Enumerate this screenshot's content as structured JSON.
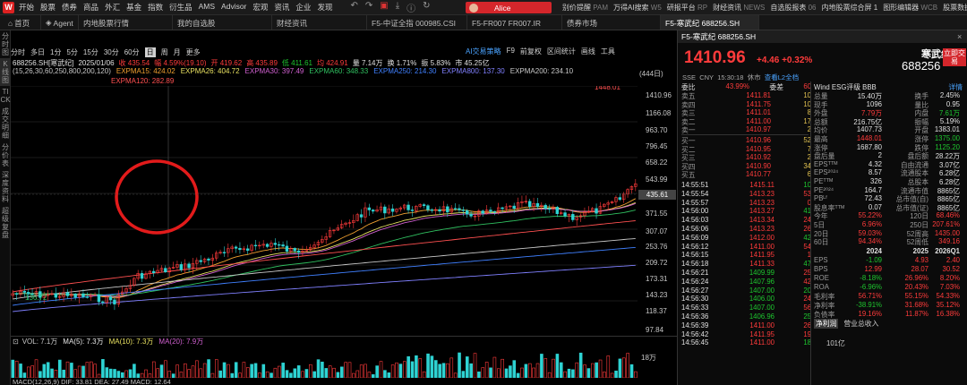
{
  "topbar": {
    "logo": "W",
    "menu": [
      "开始",
      "股票",
      "债券",
      "商品",
      "外汇",
      "基金",
      "指数",
      "衍生品",
      "AMS",
      "Advisor",
      "宏观",
      "资讯",
      "企业",
      "发现"
    ],
    "user": "Alice",
    "links": [
      {
        "t": "别价提醒",
        "g": "PAM"
      },
      {
        "t": "万得AI搜索",
        "g": "W5"
      },
      {
        "t": "研报平台",
        "g": "RP"
      },
      {
        "t": "财经资讯",
        "g": "NEWS"
      },
      {
        "t": "自选股报表",
        "g": "06"
      },
      {
        "t": "内地股票综合屏 1",
        "g": ""
      },
      {
        "t": "图形编辑器",
        "g": "WCB"
      },
      {
        "t": "股票数据浏览器",
        "g": "EDE"
      }
    ]
  },
  "tabs": [
    "首页",
    "Agent",
    "内地股票行情",
    "我的自选股",
    "财经资讯",
    "F5-中证全指 000985.CSI",
    "F5-FR007 FR007.IR",
    "债券市场",
    "F5-寒武纪 688256.SH"
  ],
  "lefttools": [
    "分时图",
    "K线图",
    "TICK",
    "成交明细",
    "分价表",
    "深度资料",
    "超级复盘"
  ],
  "periods": [
    "分时",
    "多日",
    "1分",
    "5分",
    "15分",
    "30分",
    "60分",
    "日",
    "周",
    "月",
    "更多"
  ],
  "selected_period": "日",
  "chart_links": [
    {
      "t": "AI交易策略",
      "c": "blue"
    },
    {
      "t": "F9",
      "c": ""
    },
    {
      "t": "前复权",
      "c": ""
    },
    {
      "t": "区间统计",
      "c": ""
    },
    {
      "t": "画线",
      "c": ""
    },
    {
      "t": "工具",
      "c": ""
    }
  ],
  "info": [
    {
      "t": "688256.SH[寒武纪]",
      "c": "wh"
    },
    {
      "t": "2025/01/06",
      "c": "wh"
    },
    {
      "t": "收 435.54",
      "c": "up"
    },
    {
      "t": "幅 4.59%(19.10)",
      "c": "up"
    },
    {
      "t": "开 419.62",
      "c": "up"
    },
    {
      "t": "高 435.89",
      "c": "up"
    },
    {
      "t": "低 411.61",
      "c": "dn"
    },
    {
      "t": "均 424.91",
      "c": "up"
    },
    {
      "t": "量 7.14万",
      "c": "wh"
    },
    {
      "t": "换 1.71%",
      "c": "wh"
    },
    {
      "t": "振 5.83%",
      "c": "wh"
    },
    {
      "t": "市 45.25亿",
      "c": "wh"
    }
  ],
  "ma_params": "(15,26,30,60,250,800,200,120)",
  "ma_line1": [
    {
      "t": "EXPMA15: 424.02",
      "c": "#f0a030"
    },
    {
      "t": "EXPMA26: 404.72",
      "c": "#e8e060"
    },
    {
      "t": "EXPMA30: 397.49",
      "c": "#d060d0"
    },
    {
      "t": "EXPMA60: 348.33",
      "c": "#30c060"
    },
    {
      "t": "EXPMA250: 214.30",
      "c": "#4080ff"
    },
    {
      "t": "EXPMA800: 137.30",
      "c": "#8080ff"
    },
    {
      "t": "EXPMA200: 234.10",
      "c": "#c8c8c8"
    }
  ],
  "ma_line2": {
    "t": "EXPMA120: 282.89",
    "c": "#ff5050"
  },
  "mark_count": "(444日)",
  "yaxis": [
    "1410.96",
    "1166.08",
    "963.70",
    "796.45",
    "658.22",
    "543.99",
    "371.55",
    "307.07",
    "253.76",
    "209.72",
    "173.31",
    "143.23",
    "118.37",
    "97.84"
  ],
  "current_price_tag": "435.61",
  "high_label": "1448.01",
  "low_label": "136.72",
  "vol_line": [
    {
      "t": "VOL: 7.1万",
      "c": "#c8c8c8"
    },
    {
      "t": "MA(5): 7.3万",
      "c": "#e8e8e8"
    },
    {
      "t": "MA(10): 7.3万",
      "c": "#e8e060"
    },
    {
      "t": "MA(20): 7.9万",
      "c": "#d060d0"
    }
  ],
  "vol_axis": "18万",
  "macd_line": "MACD(12,26,9)  DIF: 33.81  DEA: 27.49  MACD: 12.64",
  "chart_data": {
    "type": "candlestick",
    "trend": "from ~136.72 low to 1448.01 high over 444 days",
    "ylim": [
      97.84,
      1448.01
    ],
    "y_scale": "log",
    "last_close": 1410.96,
    "annotations": [
      "1448.01",
      "136.72"
    ]
  },
  "quote": {
    "title": "F5-寒武纪 688256.SH",
    "price": "1410.96",
    "change": "+4.46",
    "pct": "+0.32%",
    "name": "寒武纪",
    "code": "688256",
    "btn": "立即交易",
    "sub1": "SSE",
    "sub2": "CNY",
    "sub3": "15:30:18",
    "sub4": "休市",
    "sub5": "查看L2全档",
    "esg": "Wind ESG评级 BBB",
    "esg_link": "详情"
  },
  "orderbook": {
    "header": [
      "委比",
      "43.99%",
      "委差",
      "60"
    ],
    "sells": [
      [
        "卖五",
        "1411.81",
        "10"
      ],
      [
        "卖四",
        "1411.75",
        "10"
      ],
      [
        "卖三",
        "1411.01",
        "8"
      ],
      [
        "卖二",
        "1411.00",
        "17"
      ],
      [
        "卖一",
        "1410.97",
        "2"
      ]
    ],
    "buys": [
      [
        "买一",
        "1410.96",
        "52"
      ],
      [
        "买二",
        "1410.95",
        "7"
      ],
      [
        "买三",
        "1410.92",
        "2"
      ],
      [
        "买四",
        "1410.90",
        "34"
      ],
      [
        "买五",
        "1410.77",
        "6"
      ]
    ]
  },
  "stats": [
    [
      "总量",
      "15.40万",
      "换手",
      "2.45%"
    ],
    [
      "现手",
      "1096",
      "量比",
      "0.95"
    ],
    [
      "外盘",
      "7.79万",
      "内盘",
      "7.61万"
    ],
    [
      "总额",
      "216.75亿",
      "振幅",
      "5.19%"
    ],
    [
      "均价",
      "1407.73",
      "开盘",
      "1383.01"
    ],
    [
      "最高",
      "1448.01",
      "涨停",
      "1375.00"
    ],
    [
      "涨停",
      "1687.80",
      "跌停",
      "1125.20"
    ],
    [
      "盘后量",
      "2",
      "盘后额",
      "28.22万"
    ],
    [
      "EPSᵀᵀᴹ",
      "4.32",
      "自由流通",
      "3.07亿"
    ],
    [
      "EPS²⁰²⁴",
      "8.57",
      "流通股本",
      "6.28亿"
    ],
    [
      "PEᵀᵀᴹ",
      "326",
      "总股本",
      "6.28亿"
    ],
    [
      "PE²⁰²⁴",
      "164.7",
      "流通市值",
      "8865亿"
    ],
    [
      "PBᴸᶠ",
      "72.43",
      "总市值(自)",
      "8865亿"
    ],
    [
      "股息率ᵀᵀᴹ",
      "0.07",
      "总市值(证)",
      "8865亿"
    ],
    [
      "今年",
      "55.22%",
      "120日",
      "68.46%"
    ],
    [
      "5日",
      "6.96%",
      "250日",
      "207.61%"
    ],
    [
      "20日",
      "59.03%",
      "52周高",
      "1435.00"
    ],
    [
      "60日",
      "94.34%",
      "52周低",
      "349.16"
    ]
  ],
  "fin_header": [
    "",
    "2024",
    "2025",
    "2026Q1"
  ],
  "fin": [
    [
      "EPS",
      "-1.09",
      "4.93",
      "2.40"
    ],
    [
      "BPS",
      "12.99",
      "28.07",
      "30.52"
    ],
    [
      "ROE",
      "-8.18%",
      "26.96%",
      "8.20%"
    ],
    [
      "ROA",
      "-6.96%",
      "20.43%",
      "7.03%"
    ],
    [
      "毛利率",
      "56.71%",
      "55.15%",
      "54.33%"
    ],
    [
      "净利率",
      "-38.91%",
      "31.68%",
      "35.12%"
    ],
    [
      "负债率",
      "19.16%",
      "11.87%",
      "16.38%"
    ]
  ],
  "fin_tabs": [
    "净利润",
    "营业总收入"
  ],
  "fin_bottom": "101亿",
  "ticks": [
    [
      "14:55:51",
      "1415.11",
      "10"
    ],
    [
      "14:55:54",
      "1413.23",
      "53"
    ],
    [
      "14:55:57",
      "1413.23",
      "0"
    ],
    [
      "14:56:00",
      "1413.27",
      "41"
    ],
    [
      "14:56:03",
      "1413.34",
      "24"
    ],
    [
      "14:56:06",
      "1413.23",
      "26"
    ],
    [
      "14:56:09",
      "1412.00",
      "42"
    ],
    [
      "14:56:12",
      "1411.00",
      "54"
    ],
    [
      "14:56:15",
      "1411.95",
      "1"
    ],
    [
      "14:56:18",
      "1411.33",
      "47"
    ],
    [
      "14:56:21",
      "1409.99",
      "25"
    ],
    [
      "14:56:24",
      "1407.96",
      "42"
    ],
    [
      "14:56:27",
      "1407.00",
      "20"
    ],
    [
      "14:56:30",
      "1406.00",
      "24"
    ],
    [
      "14:56:33",
      "1407.00",
      "56"
    ],
    [
      "14:56:36",
      "1406.96",
      "25"
    ],
    [
      "14:56:39",
      "1411.00",
      "26"
    ],
    [
      "14:56:42",
      "1411.95",
      "19"
    ],
    [
      "14:56:45",
      "1411.00",
      "18"
    ]
  ]
}
